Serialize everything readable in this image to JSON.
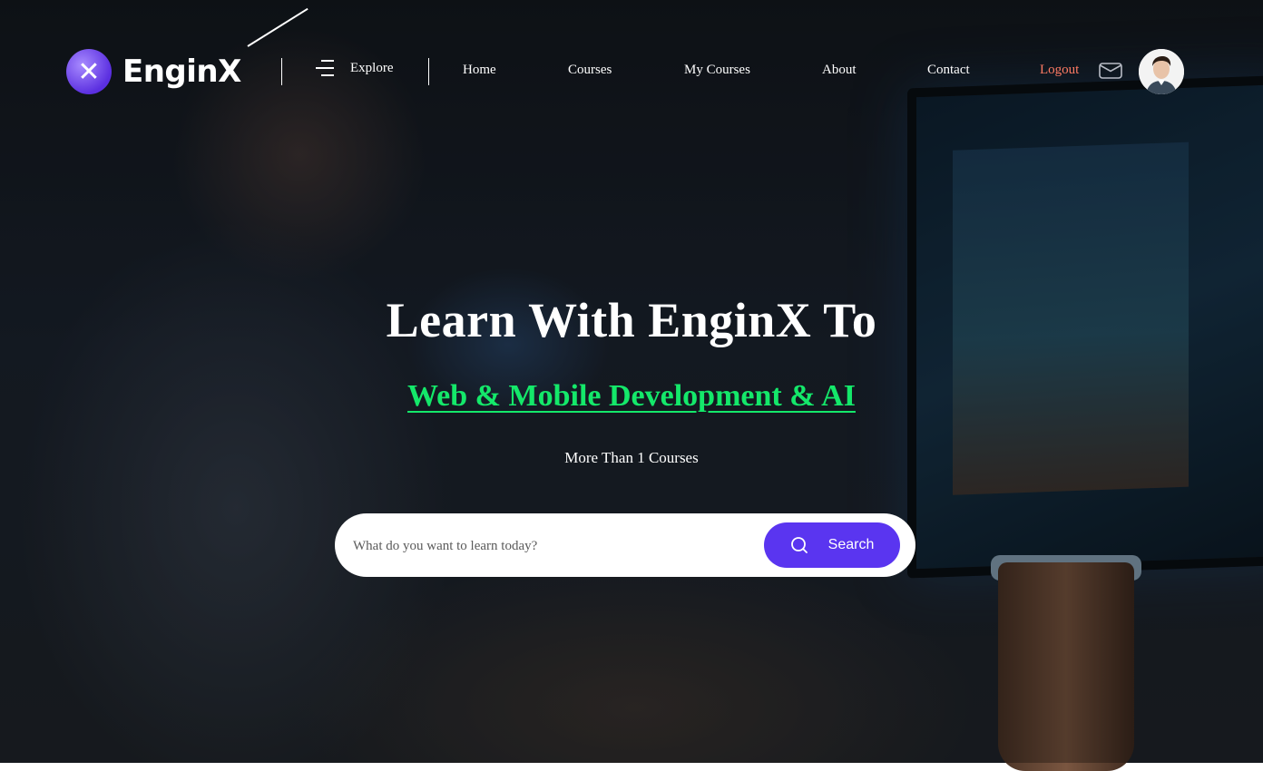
{
  "brand": {
    "logo_text": "EnginX"
  },
  "header": {
    "explore_label": "Explore",
    "nav": [
      {
        "label": "Home"
      },
      {
        "label": "Courses"
      },
      {
        "label": "My Courses"
      },
      {
        "label": "About"
      },
      {
        "label": "Contact"
      },
      {
        "label": "Logout"
      }
    ],
    "icons": {
      "menu": "hamburger-icon",
      "messages": "mail-icon",
      "profile": "avatar"
    }
  },
  "hero": {
    "title": "Learn With EnginX To",
    "subtitle": "Web & Mobile Development & AI",
    "count_text": "More Than 1 Courses"
  },
  "search": {
    "placeholder": "What do you want to learn today?",
    "value": "",
    "button_label": "Search"
  },
  "colors": {
    "accent": "#5a35f0",
    "subtitle_green": "#14e86a",
    "logout": "#ff7a63"
  }
}
